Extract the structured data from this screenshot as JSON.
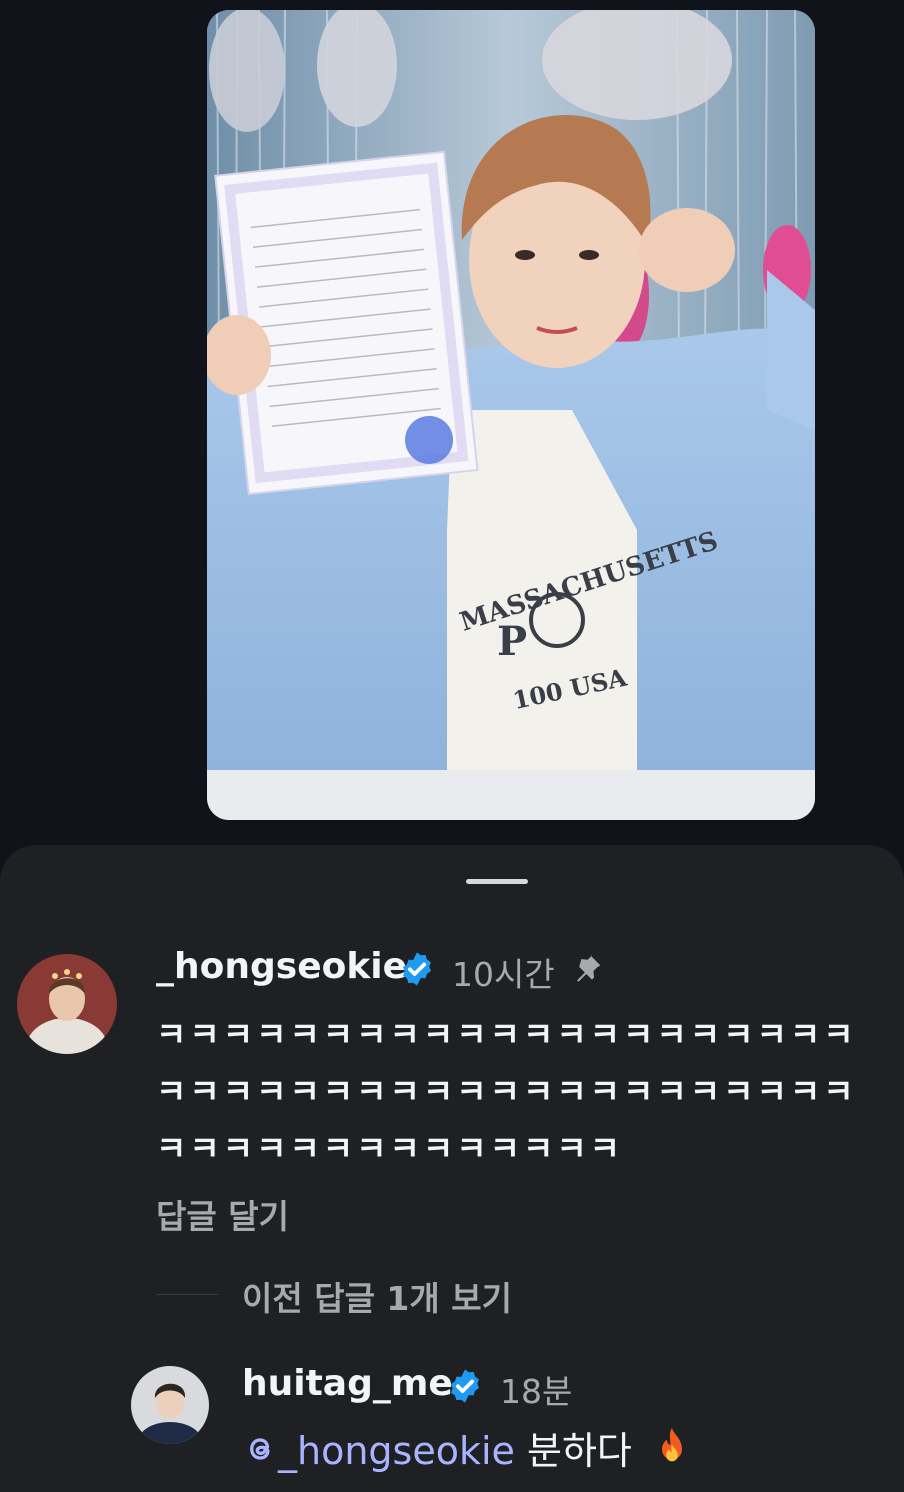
{
  "media": {
    "shirt_text": "MASSACHUSETTS",
    "shirt_letter": "P",
    "shirt_bottom": "100 USA"
  },
  "comment": {
    "username": "_hongseokie",
    "time": "10시간",
    "text": "ㅋㅋㅋㅋㅋㅋㅋㅋㅋㅋㅋㅋㅋㅋㅋㅋㅋㅋㅋㅋㅋㅋㅋㅋㅋㅋㅋㅋㅋㅋㅋㅋㅋㅋㅋㅋㅋㅋㅋㅋㅋㅋㅋㅋㅋㅋㅋㅋㅋㅋㅋㅋㅋㅋㅋㅋ",
    "reply_label": "답글 달기",
    "icons": [
      "verified-icon",
      "pin-icon"
    ]
  },
  "thread": {
    "view_previous_label": "이전 답글 1개 보기"
  },
  "reply": {
    "username": "huitag_me",
    "time": "18분",
    "mention": "_hongseokie",
    "text": "분하다",
    "icons": [
      "verified-icon",
      "threads-icon",
      "fire-icon"
    ]
  },
  "colors": {
    "background": "#10131a",
    "sheet": "#1f2024",
    "verified": "#1e9bf0",
    "mention": "#a9b4ff",
    "secondary_text": "#a7a9ad"
  }
}
